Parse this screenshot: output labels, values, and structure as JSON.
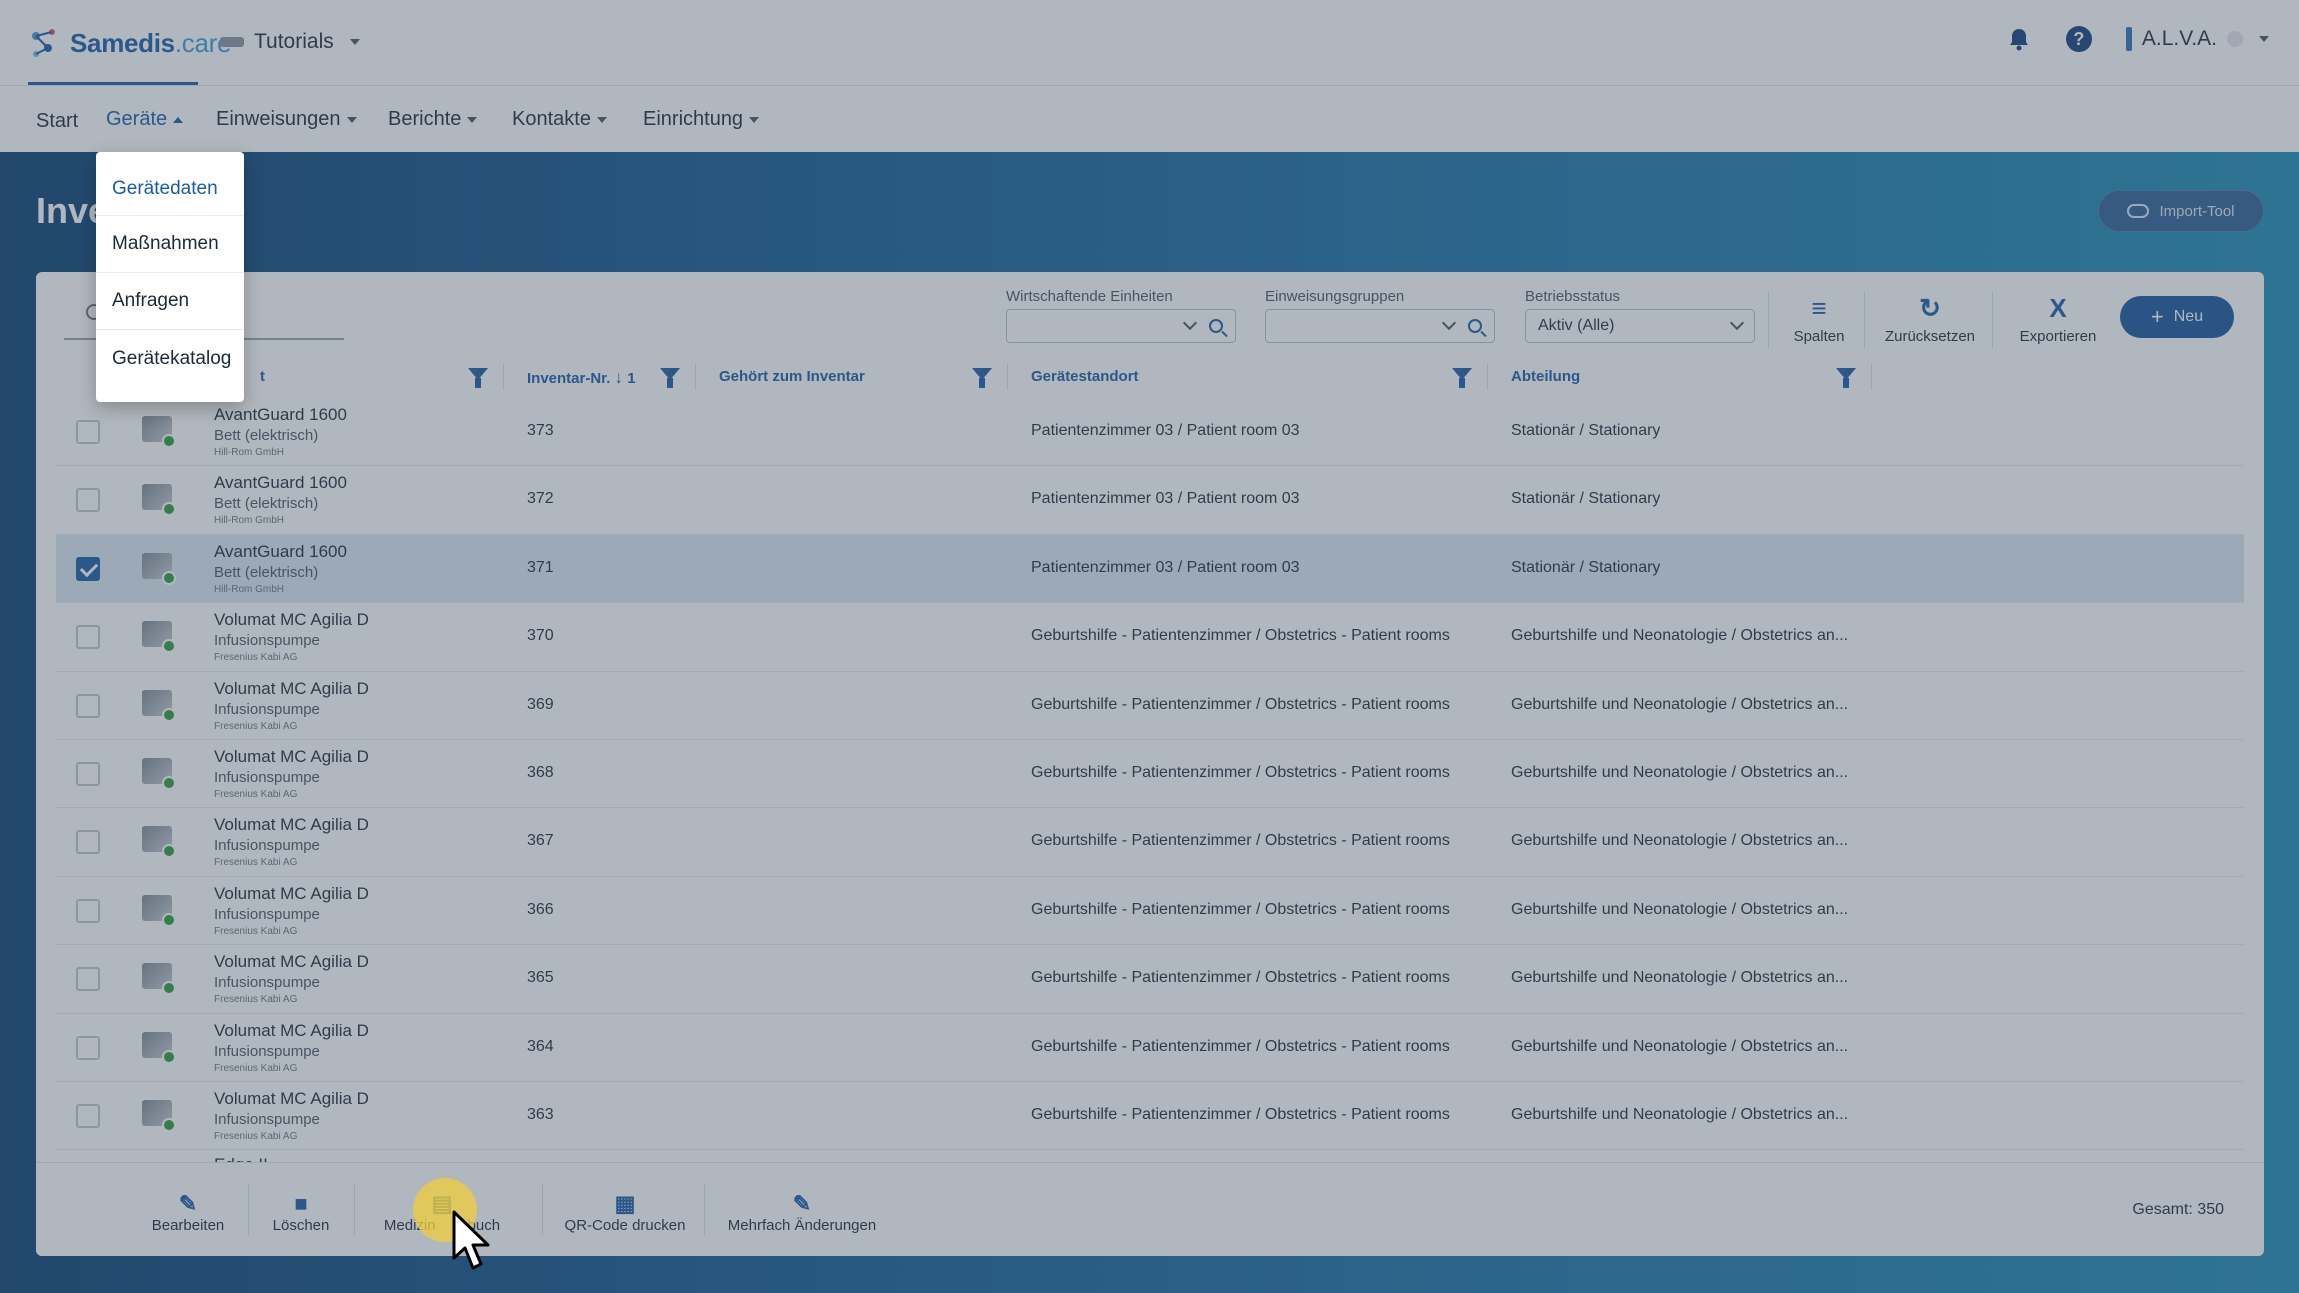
{
  "app": {
    "logo_main": "Samedis",
    "logo_suffix": ".care",
    "tenant": "Tutorials",
    "user": "A.L.V.A."
  },
  "nav": {
    "items": [
      {
        "label": "Start"
      },
      {
        "label": "Geräte"
      },
      {
        "label": "Einweisungen"
      },
      {
        "label": "Berichte"
      },
      {
        "label": "Kontakte"
      },
      {
        "label": "Einrichtung"
      }
    ],
    "active": "Geräte"
  },
  "dropdown": {
    "items": [
      "Gerätedaten",
      "Maßnahmen",
      "Anfragen",
      "Gerätekatalog"
    ]
  },
  "page": {
    "title": "Inve",
    "import_label": "Import-Tool"
  },
  "filters": {
    "wirtschaftende_label": "Wirtschaftende Einheiten",
    "einweisung_label": "Einweisungsgruppen",
    "status_label": "Betriebsstatus",
    "status_value": "Aktiv (Alle)"
  },
  "tools": {
    "spalten": "Spalten",
    "zuruecksetzen": "Zurücksetzen",
    "exportieren": "Exportieren",
    "neu": "Neu"
  },
  "table": {
    "headers": {
      "geraet": "t",
      "inventar": "Inventar-Nr.",
      "sort_index": "1",
      "inventar_zu": "Gehört zum Inventar",
      "standort": "Gerätestandort",
      "abteilung": "Abteilung"
    },
    "rows": [
      {
        "name": "AvantGuard 1600",
        "type": "Bett (elektrisch)",
        "maker": "Hill-Rom GmbH",
        "inv": "373",
        "loc": "Patientenzimmer 03 / Patient room 03",
        "dep": "Stationär / Stationary",
        "checked": false
      },
      {
        "name": "AvantGuard 1600",
        "type": "Bett (elektrisch)",
        "maker": "Hill-Rom GmbH",
        "inv": "372",
        "loc": "Patientenzimmer 03 / Patient room 03",
        "dep": "Stationär / Stationary",
        "checked": false
      },
      {
        "name": "AvantGuard 1600",
        "type": "Bett (elektrisch)",
        "maker": "Hill-Rom GmbH",
        "inv": "371",
        "loc": "Patientenzimmer 03 / Patient room 03",
        "dep": "Stationär / Stationary",
        "checked": true
      },
      {
        "name": "Volumat MC Agilia D",
        "type": "Infusionspumpe",
        "maker": "Fresenius Kabi AG",
        "inv": "370",
        "loc": "Geburtshilfe - Patientenzimmer / Obstetrics - Patient rooms",
        "dep": "Geburtshilfe und Neonatologie / Obstetrics an...",
        "checked": false
      },
      {
        "name": "Volumat MC Agilia D",
        "type": "Infusionspumpe",
        "maker": "Fresenius Kabi AG",
        "inv": "369",
        "loc": "Geburtshilfe - Patientenzimmer / Obstetrics - Patient rooms",
        "dep": "Geburtshilfe und Neonatologie / Obstetrics an...",
        "checked": false
      },
      {
        "name": "Volumat MC Agilia D",
        "type": "Infusionspumpe",
        "maker": "Fresenius Kabi AG",
        "inv": "368",
        "loc": "Geburtshilfe - Patientenzimmer / Obstetrics - Patient rooms",
        "dep": "Geburtshilfe und Neonatologie / Obstetrics an...",
        "checked": false
      },
      {
        "name": "Volumat MC Agilia D",
        "type": "Infusionspumpe",
        "maker": "Fresenius Kabi AG",
        "inv": "367",
        "loc": "Geburtshilfe - Patientenzimmer / Obstetrics - Patient rooms",
        "dep": "Geburtshilfe und Neonatologie / Obstetrics an...",
        "checked": false
      },
      {
        "name": "Volumat MC Agilia D",
        "type": "Infusionspumpe",
        "maker": "Fresenius Kabi AG",
        "inv": "366",
        "loc": "Geburtshilfe - Patientenzimmer / Obstetrics - Patient rooms",
        "dep": "Geburtshilfe und Neonatologie / Obstetrics an...",
        "checked": false
      },
      {
        "name": "Volumat MC Agilia D",
        "type": "Infusionspumpe",
        "maker": "Fresenius Kabi AG",
        "inv": "365",
        "loc": "Geburtshilfe - Patientenzimmer / Obstetrics - Patient rooms",
        "dep": "Geburtshilfe und Neonatologie / Obstetrics an...",
        "checked": false
      },
      {
        "name": "Volumat MC Agilia D",
        "type": "Infusionspumpe",
        "maker": "Fresenius Kabi AG",
        "inv": "364",
        "loc": "Geburtshilfe - Patientenzimmer / Obstetrics - Patient rooms",
        "dep": "Geburtshilfe und Neonatologie / Obstetrics an...",
        "checked": false
      },
      {
        "name": "Volumat MC Agilia D",
        "type": "Infusionspumpe",
        "maker": "Fresenius Kabi AG",
        "inv": "363",
        "loc": "Geburtshilfe - Patientenzimmer / Obstetrics - Patient rooms",
        "dep": "Geburtshilfe und Neonatologie / Obstetrics an...",
        "checked": false
      }
    ],
    "partial_row_name": "Edge II"
  },
  "bottom": {
    "bearbeiten": "Bearbeiten",
    "loeschen": "Löschen",
    "medizinprodukte_partial_a": "Medizin",
    "medizinprodukte_partial_b": "buch",
    "qr": "QR-Code drucken",
    "mehrfach": "Mehrfach Änderungen",
    "total": "Gesamt: 350"
  }
}
